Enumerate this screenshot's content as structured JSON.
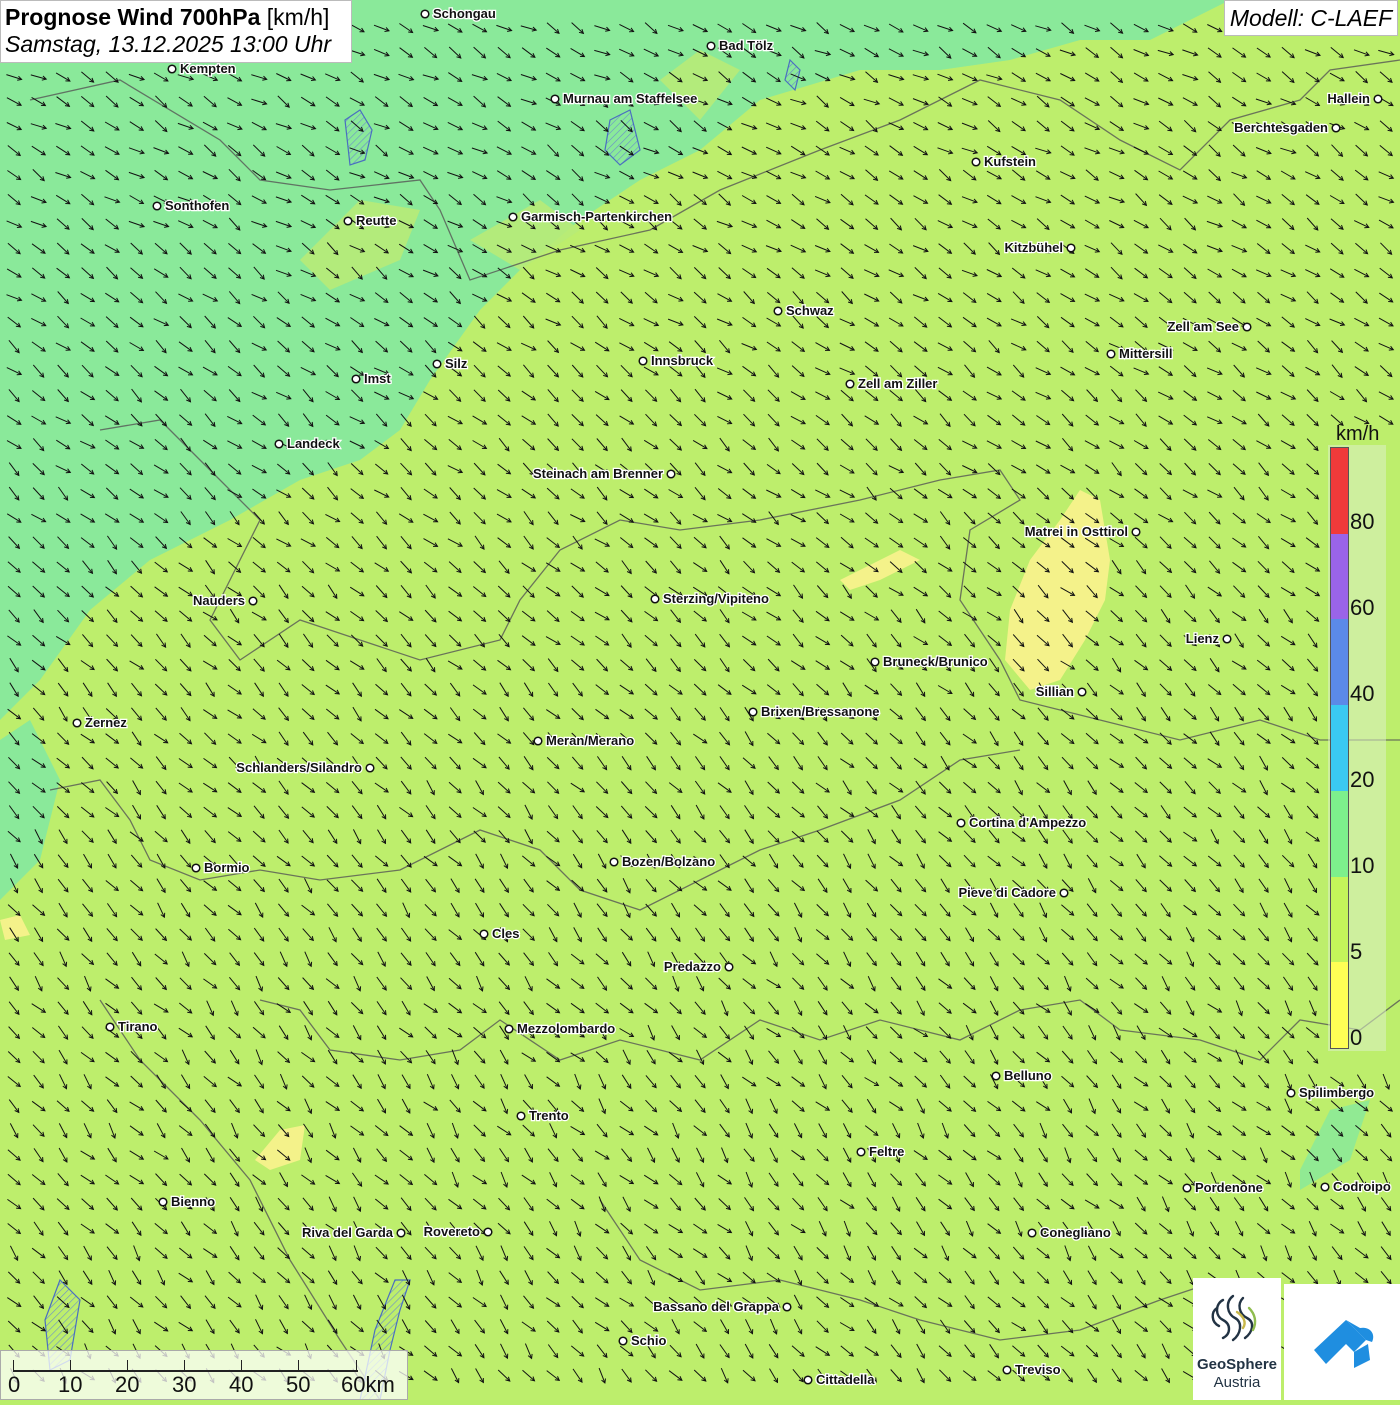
{
  "title": {
    "main": "Prognose Wind 700hPa",
    "unit": "[km/h]",
    "date": "Samstag, 13.12.2025 13:00 Uhr"
  },
  "model": "Modell: C-LAEF",
  "legend": {
    "unit": "km/h",
    "ticks": [
      "0",
      "5",
      "10",
      "20",
      "40",
      "60",
      "80"
    ],
    "colors": [
      "#ffff55",
      "#c4f55a",
      "#7df08c",
      "#3ac9f2",
      "#5b8ae8",
      "#9a64e8",
      "#f03a3a"
    ]
  },
  "scalebar": {
    "labels": [
      "0",
      "10",
      "20",
      "30",
      "40",
      "50",
      "60km"
    ]
  },
  "logo": {
    "line1": "GeoSphere",
    "line2": "Austria",
    "logo_icon": "geosphere-logo-icon",
    "app_icon": "cloud-app-icon"
  },
  "cities": [
    {
      "name": "Schongau"
    },
    {
      "name": "Bad Tölz"
    },
    {
      "name": "Kempten"
    },
    {
      "name": "Murnau am Staffelsee"
    },
    {
      "name": "Hallein"
    },
    {
      "name": "Berchtesgaden"
    },
    {
      "name": "Kufstein"
    },
    {
      "name": "Sonthofen"
    },
    {
      "name": "Reutte"
    },
    {
      "name": "Garmisch-Partenkirchen"
    },
    {
      "name": "Kitzbühel"
    },
    {
      "name": "Schwaz"
    },
    {
      "name": "Zell am See"
    },
    {
      "name": "Mittersill"
    },
    {
      "name": "Innsbruck"
    },
    {
      "name": "Silz"
    },
    {
      "name": "Imst"
    },
    {
      "name": "Zell am Ziller"
    },
    {
      "name": "Landeck"
    },
    {
      "name": "Steinach am Brenner"
    },
    {
      "name": "Matrei in Osttirol"
    },
    {
      "name": "Nauders"
    },
    {
      "name": "Sterzing/Vipiteno"
    },
    {
      "name": "Lienz"
    },
    {
      "name": "Bruneck/Brunico"
    },
    {
      "name": "Sillian"
    },
    {
      "name": "Zernez"
    },
    {
      "name": "Brixen/Bressanone"
    },
    {
      "name": "Meran/Merano"
    },
    {
      "name": "Schlanders/Silandro"
    },
    {
      "name": "Cortina d'Ampezzo"
    },
    {
      "name": "Bozen/Bolzano"
    },
    {
      "name": "Bormio"
    },
    {
      "name": "Pieve di Cadore"
    },
    {
      "name": "Cles"
    },
    {
      "name": "Predazzo"
    },
    {
      "name": "Tirano"
    },
    {
      "name": "Mezzolombardo"
    },
    {
      "name": "Belluno"
    },
    {
      "name": "Spilimbergo"
    },
    {
      "name": "Trento"
    },
    {
      "name": "Feltre"
    },
    {
      "name": "Pordenone"
    },
    {
      "name": "Codroipo"
    },
    {
      "name": "Bienno"
    },
    {
      "name": "Riva del Garda"
    },
    {
      "name": "Rovereto"
    },
    {
      "name": "Conegliano"
    },
    {
      "name": "Bassano del Grappa"
    },
    {
      "name": "Schio"
    },
    {
      "name": "Treviso"
    },
    {
      "name": "Cittadella"
    }
  ]
}
